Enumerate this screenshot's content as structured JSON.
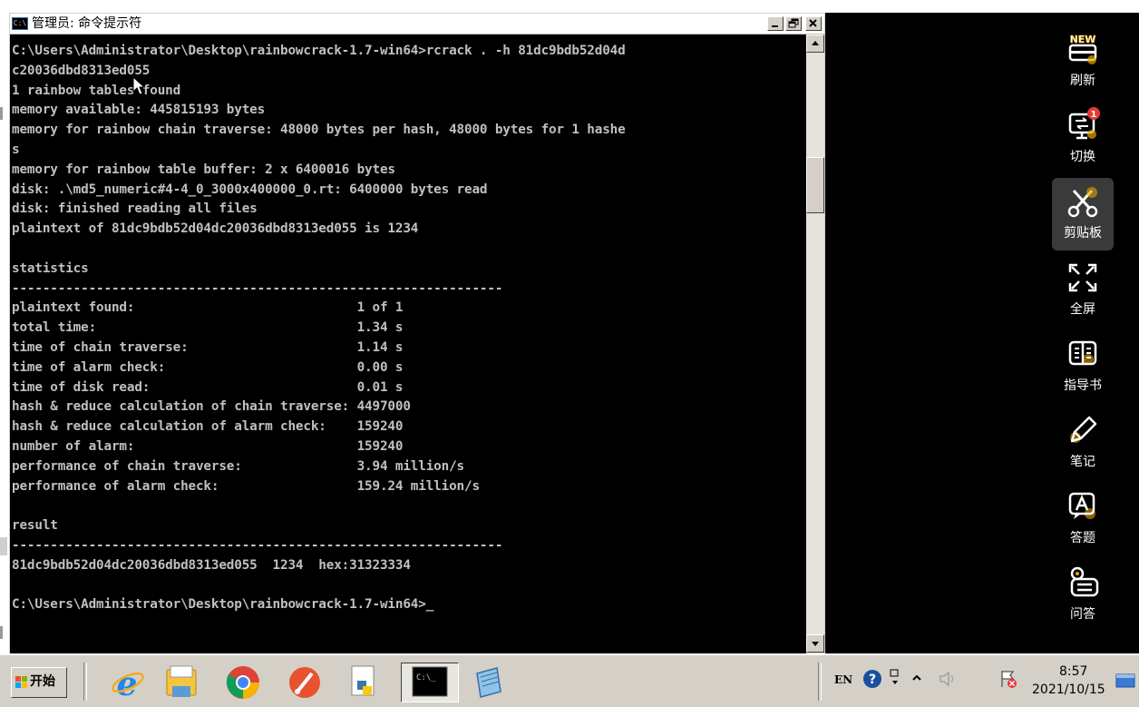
{
  "window": {
    "title": "管理员: 命令提示符",
    "icon_label": "C:\\",
    "buttons": {
      "minimize": "_",
      "maximize": "▫",
      "close": "X"
    }
  },
  "console": {
    "lines": [
      "C:\\Users\\Administrator\\Desktop\\rainbowcrack-1.7-win64>rcrack . -h 81dc9bdb52d04d",
      "c20036dbd8313ed055",
      "1 rainbow tables found",
      "memory available: 445815193 bytes",
      "memory for rainbow chain traverse: 48000 bytes per hash, 48000 bytes for 1 hashe",
      "s",
      "memory for rainbow table buffer: 2 x 6400016 bytes",
      "disk: .\\md5_numeric#4-4_0_3000x400000_0.rt: 6400000 bytes read",
      "disk: finished reading all files",
      "plaintext of 81dc9bdb52d04dc20036dbd8313ed055 is 1234",
      "",
      "statistics",
      "----------------------------------------------------------------",
      "plaintext found:                             1 of 1",
      "total time:                                  1.34 s",
      "time of chain traverse:                      1.14 s",
      "time of alarm check:                         0.00 s",
      "time of disk read:                           0.01 s",
      "hash & reduce calculation of chain traverse: 4497000",
      "hash & reduce calculation of alarm check:    159240",
      "number of alarm:                             159240",
      "performance of chain traverse:               3.94 million/s",
      "performance of alarm check:                  159.24 million/s",
      "",
      "result",
      "----------------------------------------------------------------",
      "81dc9bdb52d04dc20036dbd8313ed055  1234  hex:31323334",
      "",
      "C:\\Users\\Administrator\\Desktop\\rainbowcrack-1.7-win64>"
    ],
    "cursor": "_"
  },
  "sidebar": {
    "items": [
      {
        "label": "刷新",
        "badge": "NEW"
      },
      {
        "label": "切换",
        "count": "1"
      },
      {
        "label": "剪贴板"
      },
      {
        "label": "全屏"
      },
      {
        "label": "指导书"
      },
      {
        "label": "笔记"
      },
      {
        "label": "答题"
      },
      {
        "label": "问答"
      }
    ]
  },
  "taskbar": {
    "start_label": "开始",
    "console_icon_label": "C:\\_",
    "language": "EN",
    "time": "8:57",
    "date": "2021/10/15"
  },
  "colors": {
    "console_bg": "#000000",
    "console_fg": "#c0c0c0",
    "taskbar_bg": "#d4d0c8",
    "badge_red": "#e53935"
  }
}
